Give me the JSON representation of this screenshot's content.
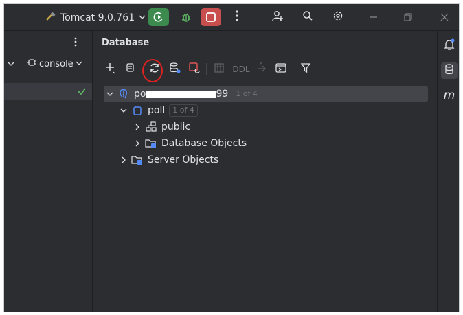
{
  "titlebar": {
    "run_config": "Tomcat 9.0.761",
    "icons": [
      "hammer-icon",
      "run-icon",
      "debug-icon",
      "stop-icon",
      "more-icon",
      "add-user-icon",
      "search-icon",
      "settings-icon",
      "minimize-icon",
      "restore-icon",
      "close-icon"
    ]
  },
  "left_panel": {
    "console_label": "console"
  },
  "database": {
    "title": "Database",
    "toolbar_icons": [
      "add-icon",
      "copy-icon",
      "refresh-icon",
      "db-settings-icon",
      "stop-query-icon",
      "table-icon",
      "ddl-icon",
      "jump-icon",
      "console-icon",
      "filter-icon"
    ],
    "ddl_label": "DDL",
    "tree": [
      {
        "label_start": "po",
        "label_end": "99",
        "badge": "1 of 4",
        "level": 0,
        "icon": "postgres-icon",
        "selected": true
      },
      {
        "label": "poll",
        "badge": "1 of 4",
        "level": 1,
        "icon": "database-icon"
      },
      {
        "label": "public",
        "level": 2,
        "icon": "schema-icon"
      },
      {
        "label": "Database Objects",
        "level": 2,
        "icon": "db-objects-icon"
      },
      {
        "label": "Server Objects",
        "level": 1,
        "icon": "server-objects-icon"
      }
    ]
  },
  "right_strip": {
    "m_label": "m"
  },
  "colors": {
    "bg": "#2b2d30",
    "run_green": "#3d8a4f",
    "stop_red": "#c94f4f",
    "accent_blue": "#548af7"
  }
}
